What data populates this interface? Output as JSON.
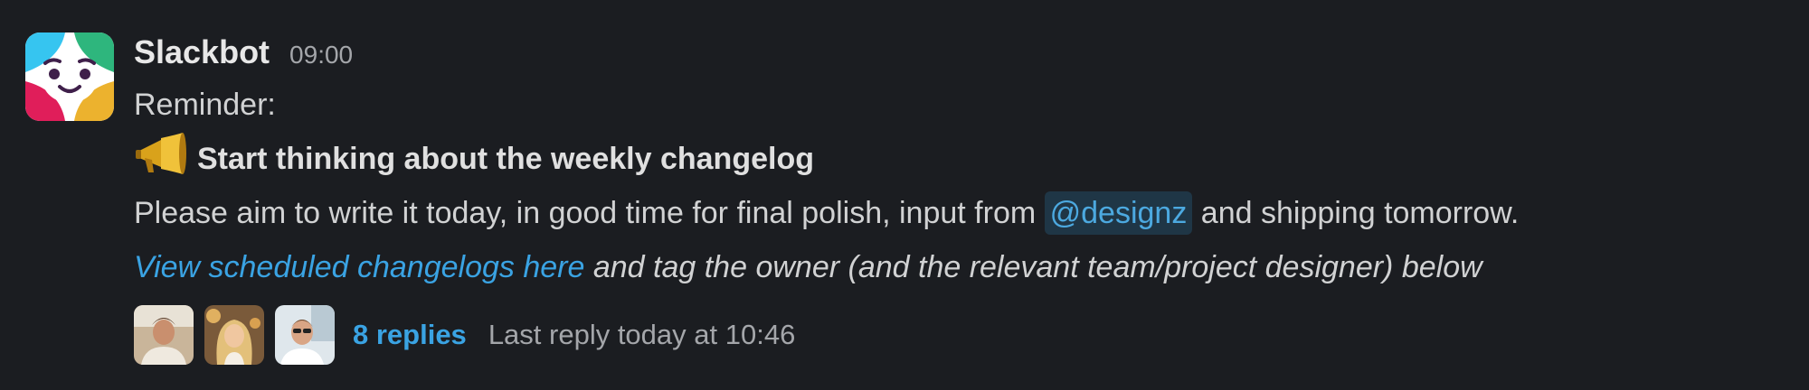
{
  "message": {
    "sender": "Slackbot",
    "timestamp": "09:00",
    "line1": "Reminder:",
    "title_icon": "megaphone-icon",
    "title": "Start thinking about the weekly changelog",
    "body_before": "Please aim to write it today, in good time for final polish, input from ",
    "mention": "@designz",
    "body_after": " and shipping tomorrow.",
    "link_text": "View scheduled changelogs here",
    "link_after": " and tag the owner (and the relevant team/project designer) below"
  },
  "thread": {
    "reply_count": "8 replies",
    "last_reply": "Last reply today at 10:46"
  },
  "colors": {
    "background": "#1b1d21",
    "link": "#3aa3e3",
    "mention_bg": "#1f3646"
  }
}
